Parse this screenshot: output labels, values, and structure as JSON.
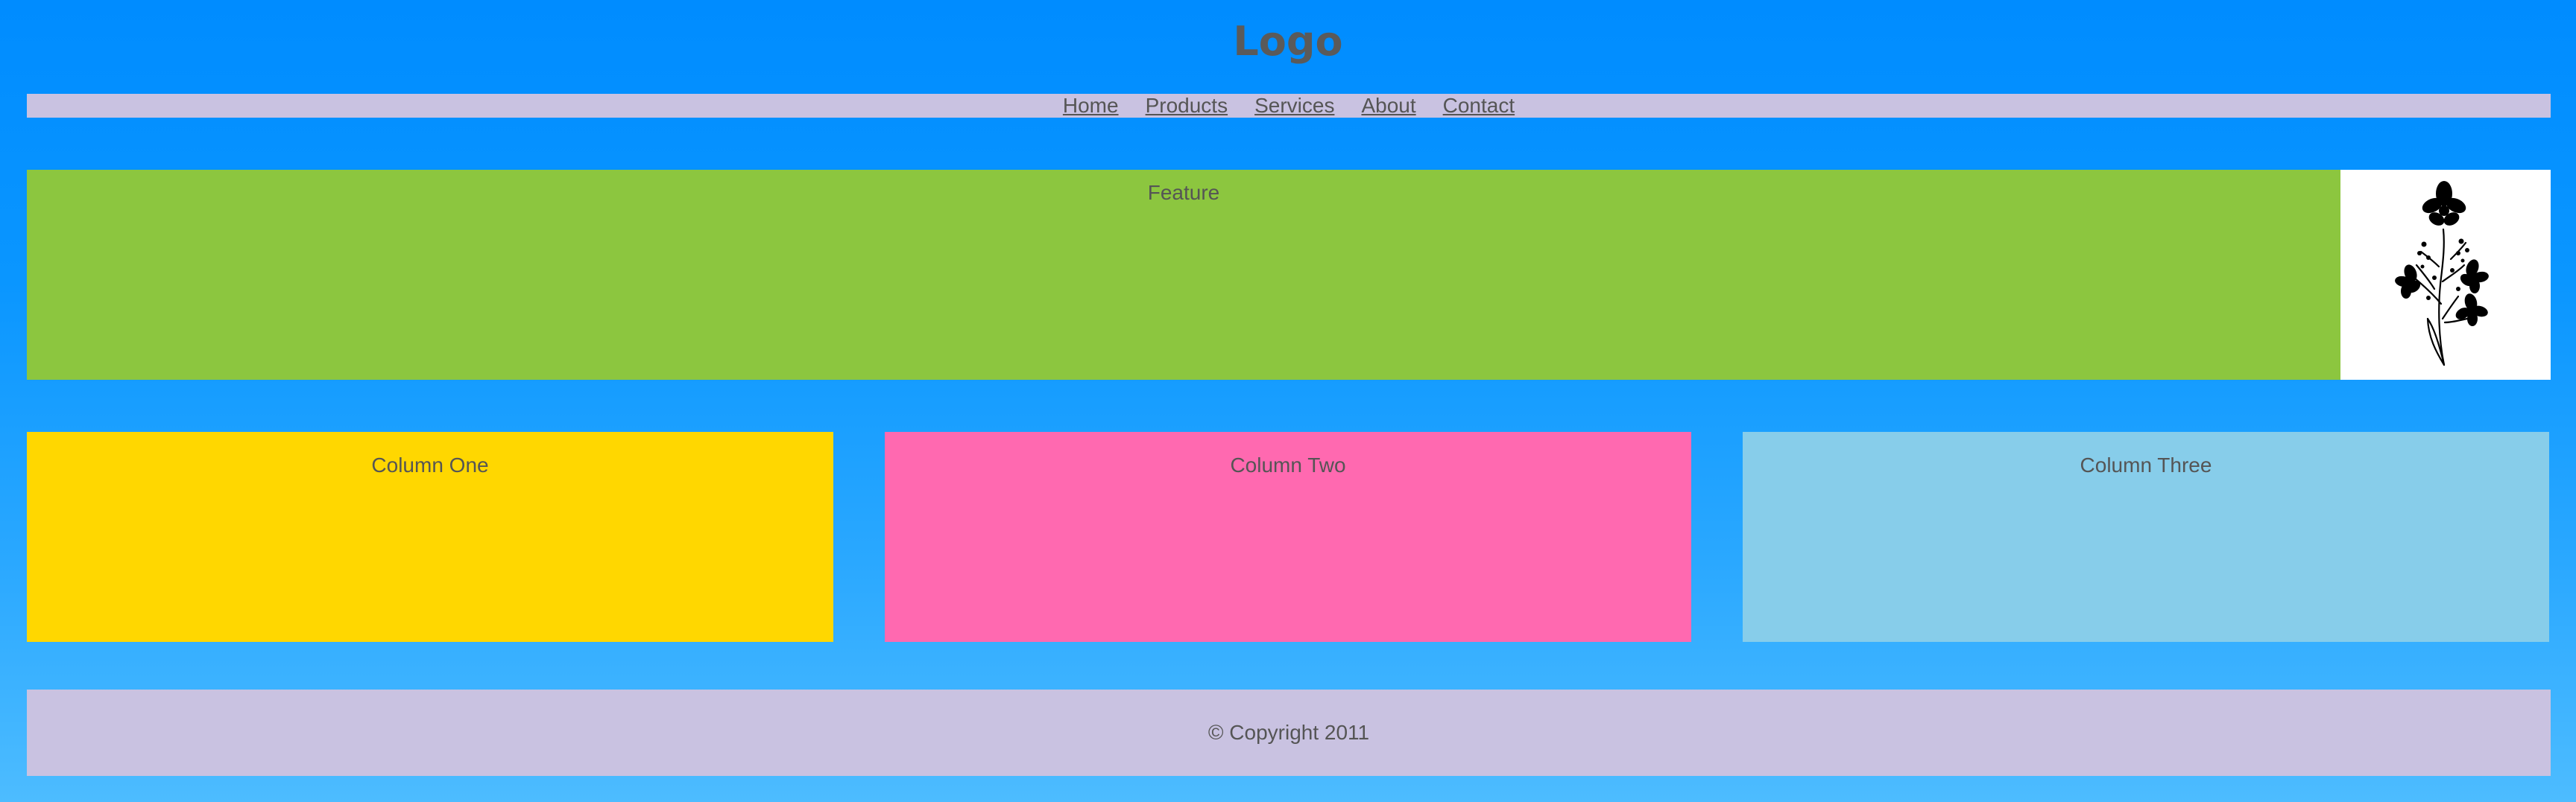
{
  "header": {
    "logo_text": "Logo"
  },
  "nav": {
    "items": [
      {
        "label": "Home"
      },
      {
        "label": "Products"
      },
      {
        "label": "Services"
      },
      {
        "label": "About"
      },
      {
        "label": "Contact"
      }
    ]
  },
  "feature": {
    "label": "Feature",
    "image_icon": "flower-bouquet-icon"
  },
  "columns": [
    {
      "label": "Column One"
    },
    {
      "label": "Column Two"
    },
    {
      "label": "Column Three"
    }
  ],
  "footer": {
    "copyright": "© Copyright 2011"
  },
  "colors": {
    "background_top": "#008cff",
    "background_bottom": "#4dbcff",
    "nav_background": "#c9c2e1",
    "feature_background": "#8cc63f",
    "column_one_background": "#ffd700",
    "column_two_background": "#ff69b0",
    "column_three_background": "#87cdea",
    "footer_background": "#c9c2e1",
    "text": "#555555"
  }
}
